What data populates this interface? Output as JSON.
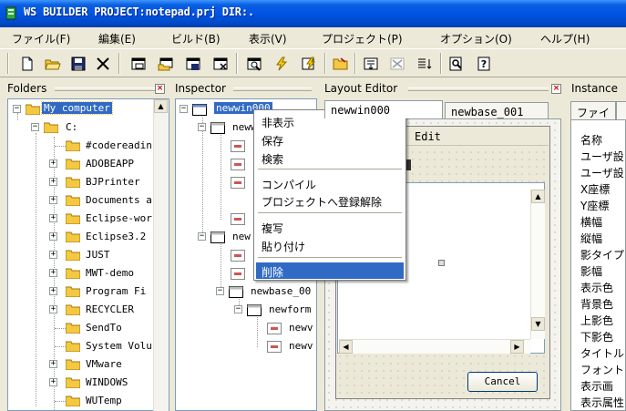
{
  "window": {
    "title": "WS BUILDER PROJECT:notepad.prj DIR:."
  },
  "menu": [
    "ファイル(F)",
    "編集(E)",
    "ビルド(B)",
    "表示(V)",
    "プロジェクト(P)",
    "オプション(O)",
    "ヘルプ(H)"
  ],
  "toolbar": [
    "new-file-icon",
    "open-folder-icon",
    "save-icon",
    "cut-icon",
    "window-icon",
    "window-open-icon",
    "window-save-icon",
    "window-close-icon",
    "find-window-icon",
    "build-icon",
    "build-all-icon",
    "folder-open-icon",
    "insert-icon",
    "delete-icon",
    "list-icon",
    "preview-icon",
    "help-icon"
  ],
  "panels": {
    "folders": "Folders",
    "inspector": "Inspector",
    "layout_editor": "Layout Editor",
    "instance": "Instance"
  },
  "folders_tree": [
    {
      "label": "My computer",
      "selected": true
    },
    {
      "label": "C:"
    },
    {
      "label": "#codereadin"
    },
    {
      "label": "ADOBEAPP"
    },
    {
      "label": "BJPrinter"
    },
    {
      "label": "Documents a"
    },
    {
      "label": "Eclipse-wor"
    },
    {
      "label": "Eclipse3.2"
    },
    {
      "label": "JUST"
    },
    {
      "label": "MWT-demo"
    },
    {
      "label": "Program Fi"
    },
    {
      "label": "RECYCLER"
    },
    {
      "label": "SendTo"
    },
    {
      "label": "System Volu"
    },
    {
      "label": "VMware"
    },
    {
      "label": "WINDOWS"
    },
    {
      "label": "WUTemp"
    }
  ],
  "inspector_tree": [
    {
      "label": "newwin000",
      "selected": true
    },
    {
      "label": "neww"
    },
    {
      "label": "n"
    },
    {
      "label": "n"
    },
    {
      "label": "n"
    },
    {
      "label": "n"
    },
    {
      "label": "new"
    },
    {
      "label": "n"
    },
    {
      "label": "n"
    },
    {
      "label": "newbase_00"
    },
    {
      "label": "newform"
    },
    {
      "label": "newv"
    },
    {
      "label": "newv"
    }
  ],
  "context_menu": {
    "items": [
      "非表示",
      "保存",
      "検索",
      "コンパイル",
      "プロジェクトへ登録解除",
      "複写",
      "貼り付け",
      "削除"
    ],
    "selected": "削除"
  },
  "layout_editor": {
    "tabs": [
      "newwin000",
      "newbase_001"
    ],
    "menu_edit": "Edit",
    "cancel_button": "Cancel"
  },
  "instance": {
    "tabs": [
      "ファイ",
      ""
    ],
    "properties": [
      "名称",
      "ユーザ設",
      "ユーザ設",
      "X座標",
      "Y座標",
      "横幅",
      "縦幅",
      "影タイプ",
      "影幅",
      "表示色",
      "背景色",
      "上影色",
      "下影色",
      "タイトル",
      "フォント",
      "表示画",
      "表示属性"
    ]
  },
  "colors": {
    "title_bar": "#0054e3",
    "selection": "#316ac5",
    "folder": "#f5c842"
  }
}
